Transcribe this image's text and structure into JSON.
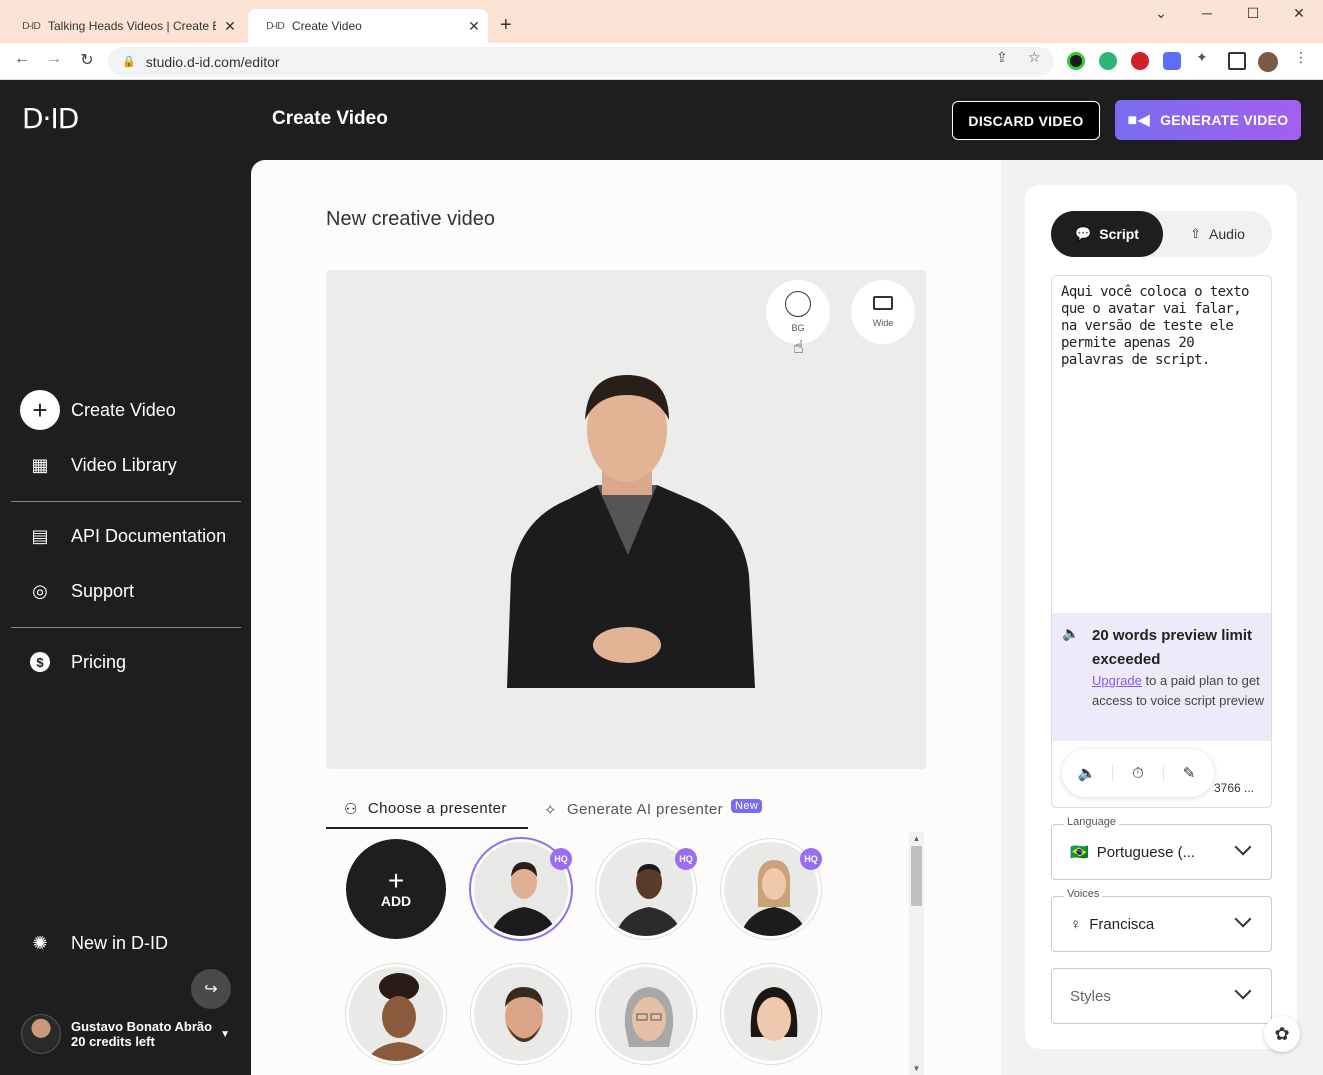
{
  "browser": {
    "tabs": [
      {
        "favicon": "D-ID",
        "label": "Talking Heads Videos | Create E-l",
        "active": false
      },
      {
        "favicon": "D-ID",
        "label": "Create Video",
        "active": true
      }
    ],
    "url": "studio.d-id.com/editor",
    "controls": {
      "back": "←",
      "forward": "→",
      "reload": "↻",
      "new_tab": "+",
      "minimize": "─",
      "maximize": "☐",
      "close": "✕",
      "tab_list": "⌄"
    }
  },
  "header": {
    "logo": "D·ID",
    "title": "Create Video",
    "discard_label": "DISCARD VIDEO",
    "generate_label": "GENERATE VIDEO"
  },
  "sidebar": {
    "items": [
      {
        "label": "Create Video",
        "icon": "plus-icon"
      },
      {
        "label": "Video Library",
        "icon": "grid-icon"
      },
      {
        "label": "API Documentation",
        "icon": "document-icon"
      },
      {
        "label": "Support",
        "icon": "lifebuoy-icon"
      },
      {
        "label": "Pricing",
        "icon": "dollar-icon"
      },
      {
        "label": "New in D-ID",
        "icon": "party-icon"
      }
    ],
    "user": {
      "name": "Gustavo Bonato Abrão",
      "credits": "20 credits left"
    }
  },
  "main": {
    "title": "New creative video",
    "canvas_buttons": {
      "bg": "BG",
      "wide": "Wide"
    },
    "presenter_tabs": {
      "choose": "Choose a presenter",
      "generate": "Generate AI presenter",
      "new_badge": "New"
    },
    "add_label": "ADD",
    "hq_badge": "HQ"
  },
  "panel": {
    "tabs": {
      "script": "Script",
      "audio": "Audio"
    },
    "script_text": "Aqui você coloca o texto que o avatar vai falar, na versão de teste ele permite apenas 20 palavras de script.",
    "warning": {
      "title": "20 words preview limit exceeded",
      "link": "Upgrade",
      "body": " to a paid plan to get access to voice script preview"
    },
    "char_count": "3766 ...",
    "language": {
      "label": "Language",
      "value": "Portuguese (...",
      "flag": "🇧🇷"
    },
    "voices": {
      "label": "Voices",
      "value": "Francisca"
    },
    "styles": {
      "placeholder": "Styles"
    }
  },
  "colors": {
    "accent": "#7a6cf0",
    "sidebar_bg": "#1e1e20",
    "warning_bg": "#efeaf9"
  }
}
